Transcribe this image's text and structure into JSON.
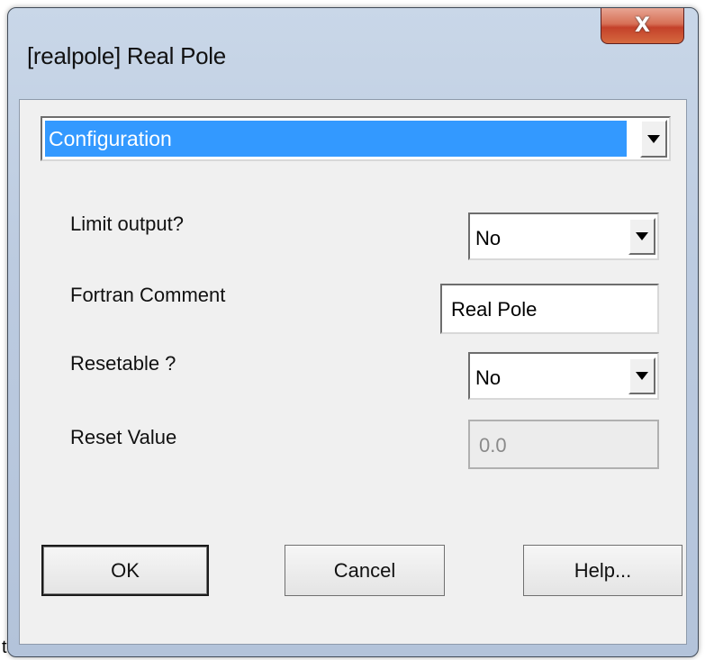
{
  "window": {
    "title": "[realpole] Real Pole",
    "close_glyph": "X"
  },
  "stray_text": "t",
  "category": {
    "selected": "Configuration"
  },
  "fields": {
    "limit_output": {
      "label": "Limit output?",
      "value": "No"
    },
    "fortran_comment": {
      "label": "Fortran Comment",
      "value": "Real Pole"
    },
    "resetable": {
      "label": "Resetable ?",
      "value": "No"
    },
    "reset_value": {
      "label": "Reset Value",
      "value": "0.0",
      "disabled": true
    }
  },
  "buttons": {
    "ok": "OK",
    "cancel": "Cancel",
    "help": "Help..."
  },
  "colors": {
    "selection": "#3399ff",
    "close_button": "#c4412a",
    "frame": "#bccbe0",
    "client": "#f0f0f0"
  }
}
